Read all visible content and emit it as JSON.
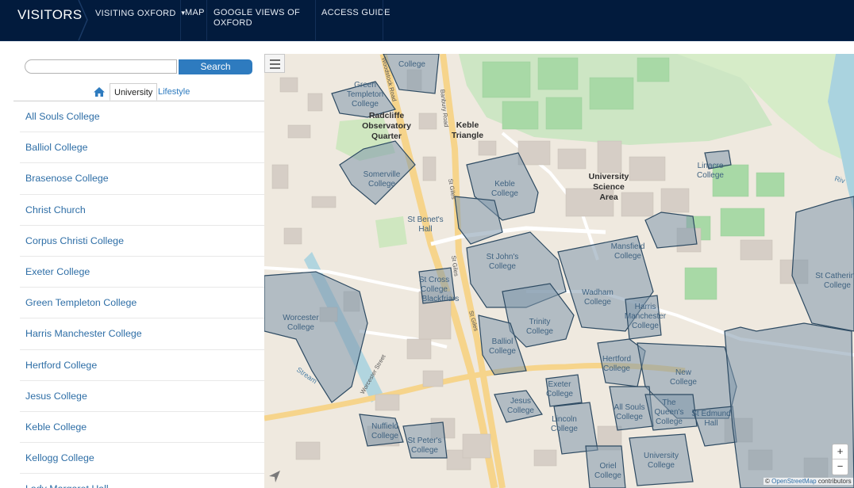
{
  "header": {
    "brand": "VISITORS",
    "nav": [
      {
        "label": "VISITING OXFORD",
        "dropdown": true
      },
      {
        "label": "MAP"
      },
      {
        "label_line1": "GOOGLE VIEWS OF",
        "label_line2": "OXFORD"
      },
      {
        "label": "ACCESS GUIDE"
      }
    ]
  },
  "sidebar": {
    "search": {
      "value": "",
      "placeholder": "",
      "button_label": "Search"
    },
    "tabs": {
      "home_icon": "home-icon",
      "university": "University",
      "lifestyle": "Lifestyle",
      "active": "University"
    },
    "items": [
      "All Souls College",
      "Balliol College",
      "Brasenose College",
      "Christ Church",
      "Corpus Christi College",
      "Exeter College",
      "Green Templeton College",
      "Harris Manchester College",
      "Hertford College",
      "Jesus College",
      "Keble College",
      "Kellogg College",
      "Lady Margaret Hall"
    ]
  },
  "map": {
    "zoom_in": "+",
    "zoom_out": "−",
    "attribution_prefix": "©",
    "attribution_link": "OpenStreetMap",
    "attribution_suffix": "contributors",
    "labels": {
      "green_templeton": [
        "Green",
        "Templeton",
        "College"
      ],
      "college_top": "College",
      "radcliffe": [
        "Radcliffe",
        "Observatory",
        "Quarter"
      ],
      "keble_triangle": [
        "Keble",
        "Triangle"
      ],
      "science_area": [
        "University",
        "Science",
        "Area"
      ],
      "linacre": [
        "Linacre",
        "College"
      ],
      "somerville": [
        "Somerville",
        "College"
      ],
      "keble": [
        "Keble",
        "College"
      ],
      "st_benets": [
        "St Benet's",
        "Hall"
      ],
      "st_johns": [
        "St John's",
        "College"
      ],
      "mansfield": [
        "Mansfield",
        "College"
      ],
      "st_catherines": [
        "St Catherine",
        "College"
      ],
      "st_cross": [
        "St Cross",
        "College",
        "Blackfriars"
      ],
      "wadham": [
        "Wadham",
        "College"
      ],
      "harris": [
        "Harris",
        "Manchester",
        "College"
      ],
      "worcester": [
        "Worcester",
        "College"
      ],
      "trinity": [
        "Trinity",
        "College"
      ],
      "balliol": [
        "Balliol",
        "College"
      ],
      "hertford": [
        "Hertford",
        "College"
      ],
      "new": [
        "New",
        "College"
      ],
      "exeter": [
        "Exeter",
        "College"
      ],
      "jesus": [
        "Jesus",
        "College"
      ],
      "all_souls": [
        "All Souls",
        "College"
      ],
      "queens": [
        "The",
        "Queen's",
        "College"
      ],
      "st_edmund": [
        "St Edmund",
        "Hall"
      ],
      "lincoln": [
        "Lincoln",
        "College"
      ],
      "nuffield": [
        "Nuffield",
        "College"
      ],
      "st_peters": [
        "St Peter's",
        "College"
      ],
      "university": [
        "University",
        "College"
      ],
      "oriel": [
        "Oriel",
        "College"
      ],
      "woodstock_road": "Woodstock Road",
      "banbury_road": "Banbury Road",
      "st_giles": "St Giles",
      "st_giles_2": "St Giles",
      "st_giles_3": "St Giles",
      "worcester_street": "Worcester Street",
      "stream": "Stream",
      "river": "Riv"
    }
  }
}
